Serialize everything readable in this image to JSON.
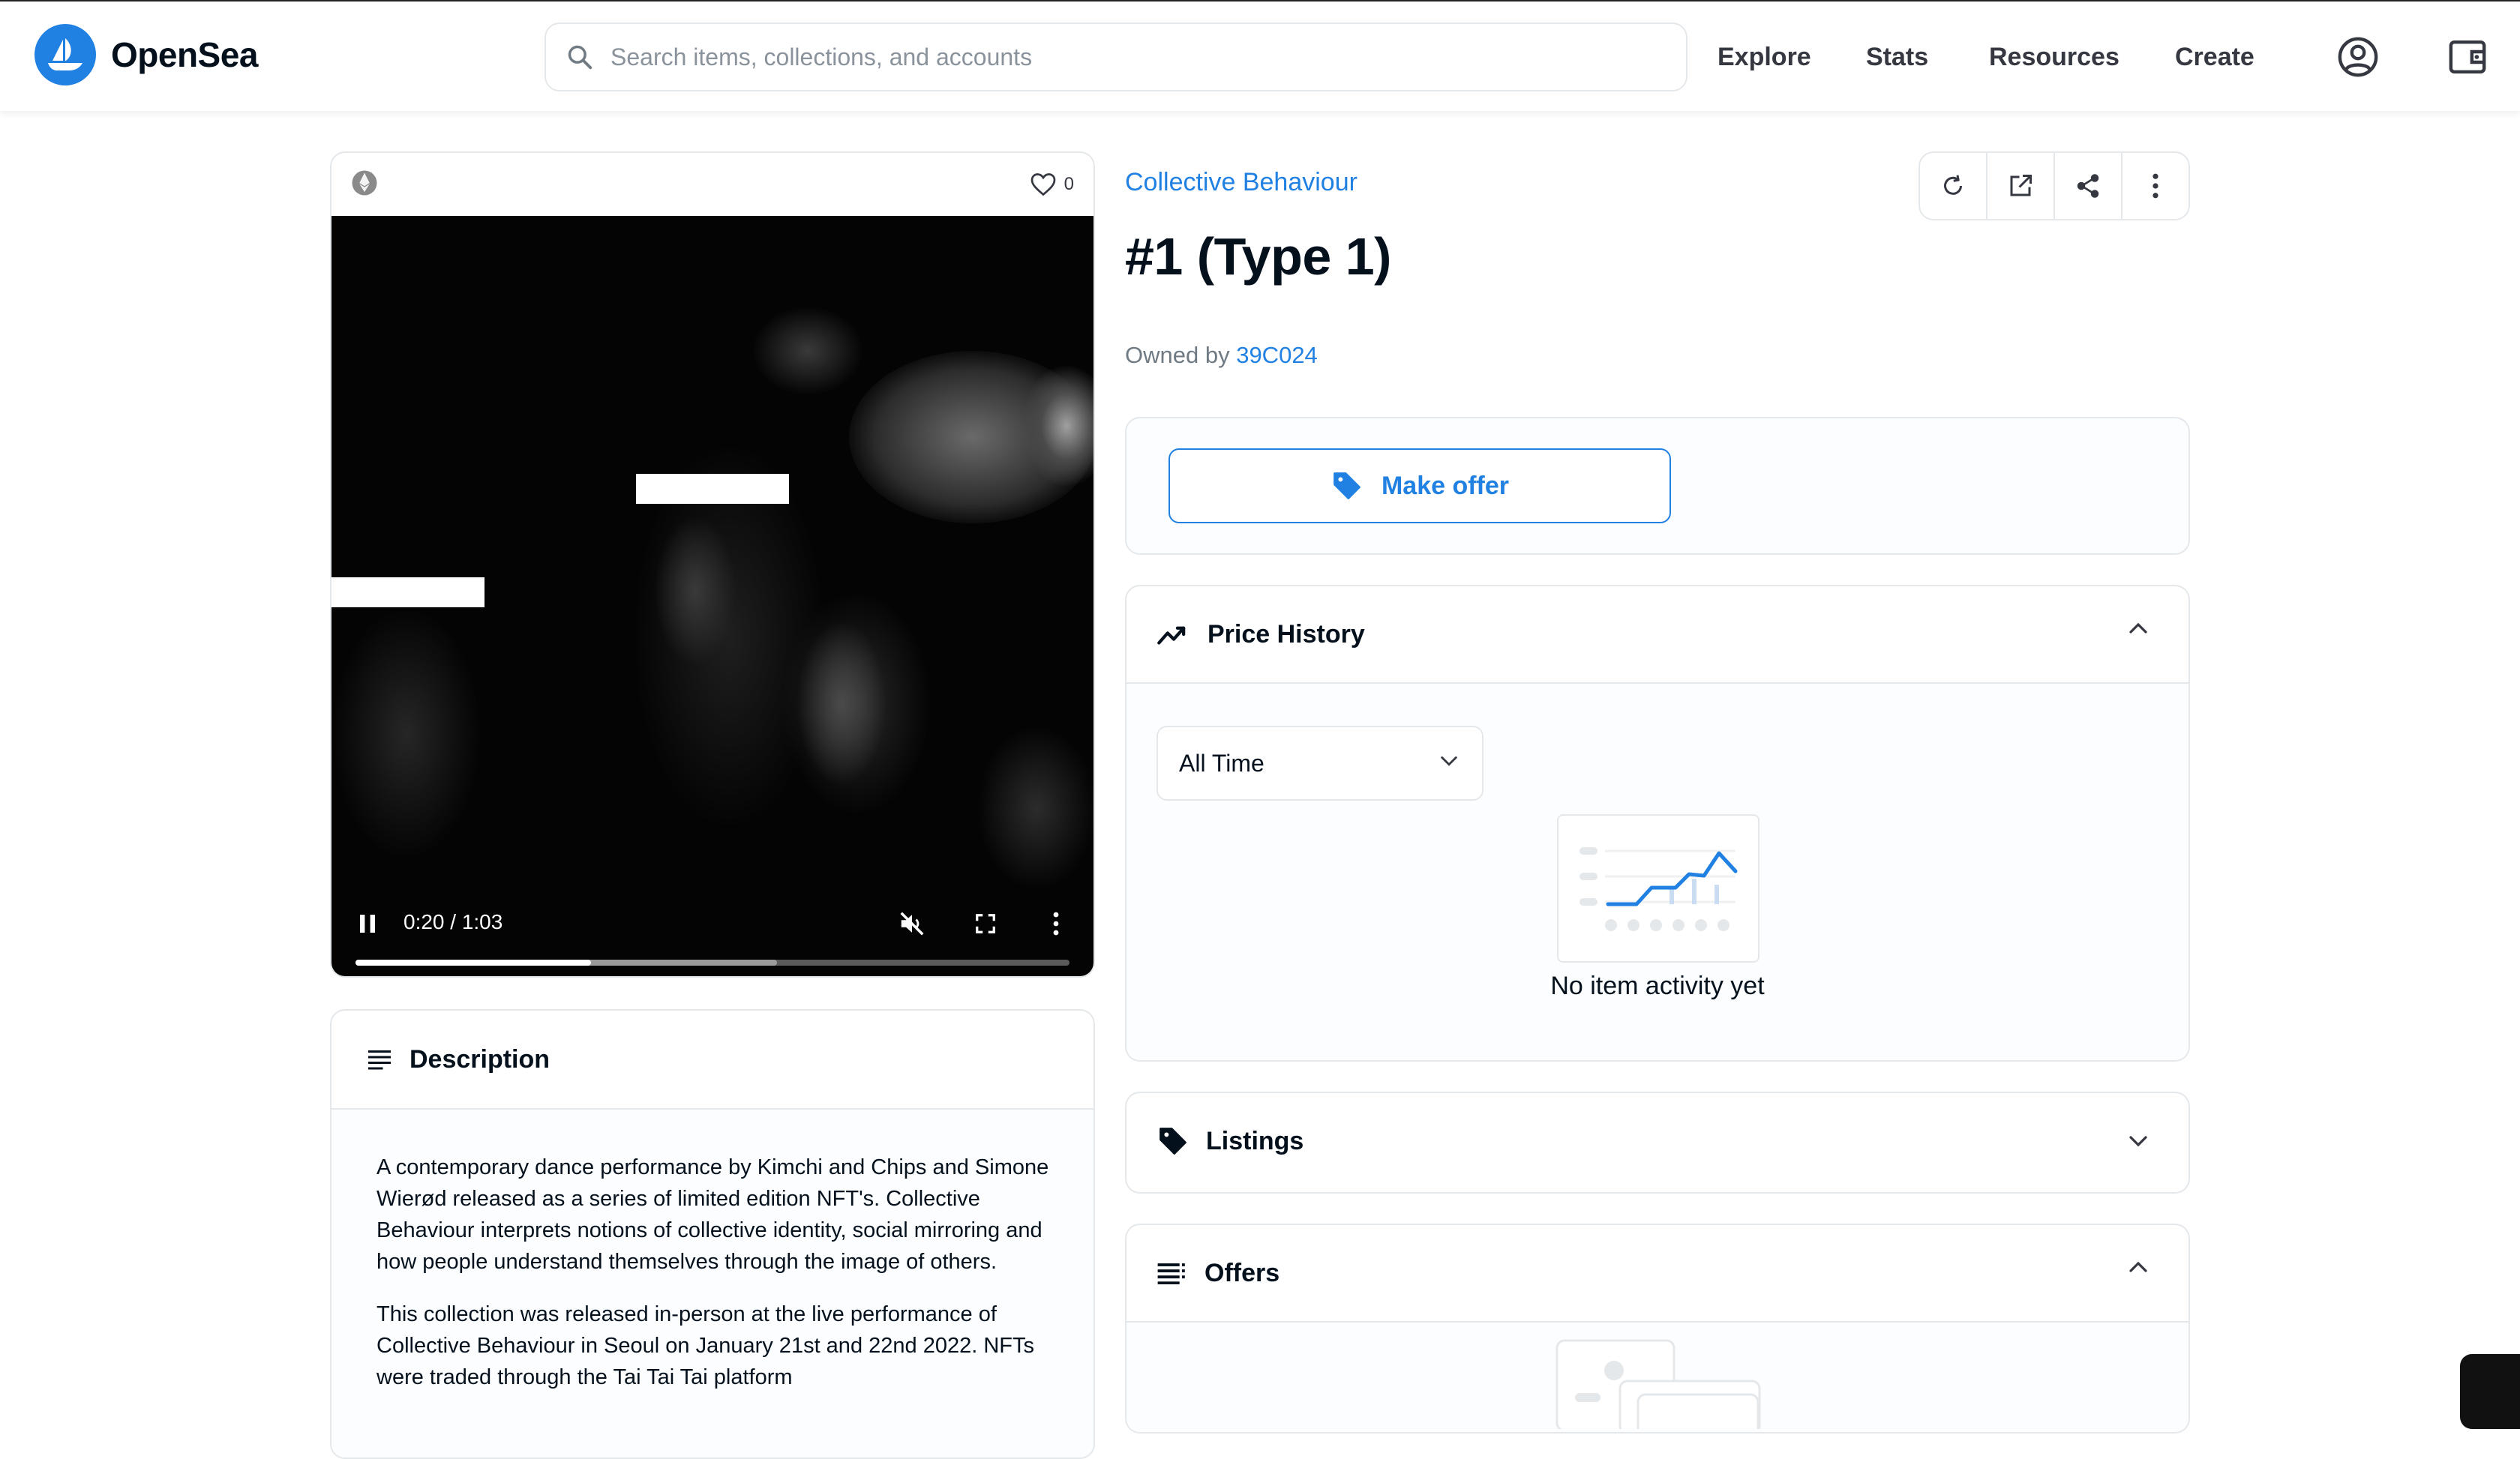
{
  "header": {
    "brand": "OpenSea",
    "search_placeholder": "Search items, collections, and accounts",
    "nav": [
      "Explore",
      "Stats",
      "Resources",
      "Create"
    ],
    "icons": [
      "account-icon",
      "wallet-icon"
    ]
  },
  "media": {
    "chain_icon": "ethereum-icon",
    "favorites_count": "0",
    "video": {
      "time": "0:20 / 1:03",
      "progress": 0.33,
      "buffered": 0.59
    }
  },
  "description": {
    "title": "Description",
    "paragraphs": [
      "A contemporary dance performance by Kimchi and Chips and Simone Wierød released as a series of limited edition NFT's. Collective Behaviour interprets notions of collective identity, social mirroring and how people understand themselves through the image of others.",
      "This collection was released in-person at the live performance of Collective Behaviour in Seoul on January 21st and 22nd 2022. NFTs were traded through the Tai Tai Tai platform"
    ]
  },
  "item": {
    "collection": "Collective Behaviour",
    "title": "#1 (Type 1)",
    "owned_prefix": "Owned by",
    "owner": "39C024"
  },
  "actions": [
    "refresh-icon",
    "external-link-icon",
    "share-icon",
    "more-icon"
  ],
  "offer": {
    "button_label": "Make offer"
  },
  "price_history": {
    "title": "Price History",
    "filter": "All Time",
    "empty": "No item activity yet"
  },
  "listings": {
    "title": "Listings"
  },
  "offers": {
    "title": "Offers"
  },
  "colors": {
    "accent": "#2081e2",
    "border": "#e5e8eb",
    "text": "#04111d"
  }
}
